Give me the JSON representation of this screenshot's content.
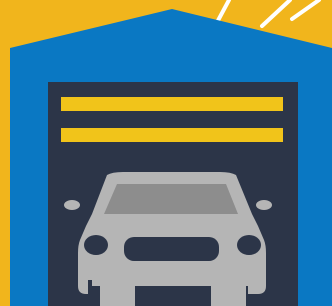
{
  "illustration": {
    "subject": "garage-with-car-icon"
  },
  "colors": {
    "background": "#f1b51c",
    "sun_rays": "#ffffff",
    "garage_outline": "#0a78c3",
    "garage_interior": "#2c3548",
    "door_stripes": "#f1c41a",
    "car_body": "#b5b5b5",
    "car_dark_details": "#2c3548",
    "car_window": "#8d8d8d"
  }
}
